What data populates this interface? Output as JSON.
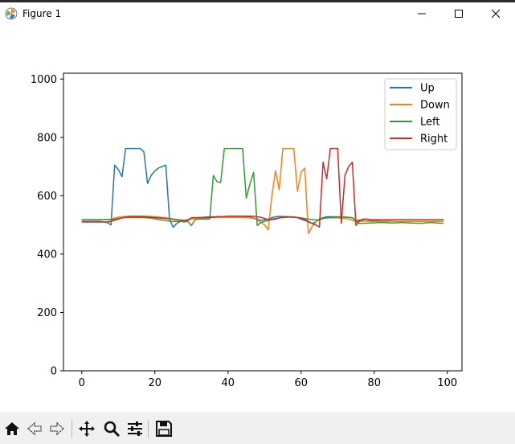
{
  "window": {
    "title": "Figure 1",
    "minimize_glyph": "—",
    "maximize_glyph": "☐",
    "close_glyph": "✕"
  },
  "toolbar": {
    "items": [
      "home-icon",
      "back-arrow-icon",
      "forward-arrow-icon",
      "pan-icon",
      "zoom-icon",
      "configure-subplots-icon",
      "save-icon"
    ]
  },
  "chart_data": {
    "type": "line",
    "title": "",
    "xlabel": "",
    "ylabel": "",
    "xlim": [
      -5,
      104
    ],
    "ylim": [
      0,
      1020
    ],
    "xticks": [
      0,
      20,
      40,
      60,
      80,
      100
    ],
    "yticks": [
      0,
      200,
      400,
      600,
      800,
      1000
    ],
    "xtick_labels": [
      "0",
      "20",
      "40",
      "60",
      "80",
      "100"
    ],
    "ytick_labels": [
      "0",
      "200",
      "400",
      "600",
      "800",
      "1000"
    ],
    "grid": false,
    "legend": "top-right",
    "x": [
      0,
      1,
      2,
      3,
      4,
      5,
      6,
      7,
      8,
      9,
      10,
      11,
      12,
      13,
      14,
      15,
      16,
      17,
      18,
      19,
      20,
      21,
      22,
      23,
      24,
      25,
      26,
      27,
      28,
      29,
      30,
      31,
      32,
      33,
      34,
      35,
      36,
      37,
      38,
      39,
      40,
      41,
      42,
      43,
      44,
      45,
      46,
      47,
      48,
      49,
      50,
      51,
      52,
      53,
      54,
      55,
      56,
      57,
      58,
      59,
      60,
      61,
      62,
      63,
      64,
      65,
      66,
      67,
      68,
      69,
      70,
      71,
      72,
      73,
      74,
      75,
      76,
      77,
      78,
      79,
      80,
      81,
      82,
      83,
      84,
      85,
      86,
      87,
      88,
      89,
      90,
      91,
      92,
      93,
      94,
      95,
      96,
      97,
      98,
      99
    ],
    "series": [
      {
        "name": "Up",
        "color": "#1f77b4",
        "values": [
          512,
          512,
          512,
          512,
          512,
          512,
          510,
          508,
          500,
          705,
          690,
          665,
          762,
          762,
          762,
          762,
          762,
          750,
          642,
          670,
          685,
          695,
          700,
          705,
          520,
          492,
          505,
          512,
          515,
          518,
          522,
          524,
          525,
          526,
          527,
          528,
          528,
          528,
          528,
          528,
          528,
          528,
          528,
          528,
          528,
          527,
          526,
          524,
          520,
          515,
          518,
          520,
          525,
          528,
          529,
          529,
          528,
          527,
          526,
          525,
          520,
          515,
          510,
          505,
          510,
          520,
          525,
          528,
          528,
          528,
          528,
          528,
          527,
          526,
          525,
          515,
          517,
          515,
          514,
          514,
          514,
          514,
          513,
          513,
          513,
          512,
          512,
          512,
          512,
          512,
          512,
          512,
          512,
          512,
          512,
          512,
          512,
          512,
          512,
          512
        ]
      },
      {
        "name": "Down",
        "color": "#ff7f0e",
        "values": [
          518,
          518,
          518,
          518,
          518,
          518,
          518,
          519,
          520,
          524,
          527,
          528,
          529,
          530,
          530,
          530,
          530,
          530,
          530,
          529,
          528,
          527,
          526,
          525,
          522,
          520,
          518,
          517,
          516,
          516,
          520,
          522,
          523,
          524,
          524,
          525,
          525,
          526,
          526,
          526,
          526,
          526,
          526,
          526,
          526,
          525,
          524,
          522,
          518,
          508,
          500,
          483,
          600,
          685,
          620,
          762,
          762,
          762,
          762,
          615,
          680,
          695,
          470,
          495,
          510,
          518,
          522,
          524,
          524,
          524,
          524,
          523,
          522,
          520,
          516,
          510,
          512,
          513,
          513,
          512,
          512,
          512,
          512,
          512,
          512,
          512,
          512,
          512,
          512,
          512,
          512,
          512,
          512,
          512,
          512,
          512,
          512,
          512,
          512,
          512
        ]
      },
      {
        "name": "Left",
        "color": "#2ca02c",
        "values": [
          518,
          518,
          518,
          518,
          518,
          518,
          518,
          518,
          518,
          520,
          522,
          524,
          525,
          525,
          525,
          525,
          525,
          525,
          524,
          523,
          521,
          519,
          517,
          515,
          513,
          512,
          512,
          512,
          510,
          512,
          498,
          518,
          520,
          520,
          520,
          520,
          670,
          648,
          645,
          762,
          762,
          762,
          762,
          762,
          762,
          592,
          640,
          680,
          498,
          508,
          512,
          515,
          520,
          522,
          524,
          525,
          526,
          527,
          527,
          526,
          524,
          522,
          520,
          518,
          517,
          518,
          522,
          524,
          525,
          526,
          527,
          527,
          527,
          526,
          524,
          515,
          505,
          506,
          506,
          507,
          507,
          508,
          508,
          508,
          507,
          507,
          507,
          508,
          508,
          507,
          507,
          506,
          506,
          506,
          507,
          508,
          508,
          507,
          506,
          506
        ]
      },
      {
        "name": "Right",
        "color": "#d62728",
        "values": [
          510,
          510,
          510,
          510,
          510,
          510,
          510,
          510,
          512,
          516,
          520,
          524,
          527,
          528,
          529,
          529,
          529,
          528,
          527,
          526,
          525,
          524,
          523,
          522,
          521,
          520,
          518,
          516,
          515,
          515,
          525,
          525,
          525,
          525,
          525,
          525,
          527,
          528,
          528,
          529,
          530,
          530,
          530,
          530,
          530,
          530,
          530,
          530,
          528,
          526,
          522,
          518,
          518,
          520,
          524,
          527,
          528,
          528,
          527,
          525,
          522,
          518,
          512,
          505,
          500,
          493,
          715,
          658,
          762,
          762,
          762,
          505,
          670,
          700,
          715,
          498,
          515,
          520,
          520,
          518,
          518,
          518,
          518,
          518,
          518,
          518,
          518,
          518,
          518,
          518,
          518,
          518,
          518,
          518,
          518,
          518,
          518,
          518,
          518,
          518
        ]
      }
    ]
  }
}
